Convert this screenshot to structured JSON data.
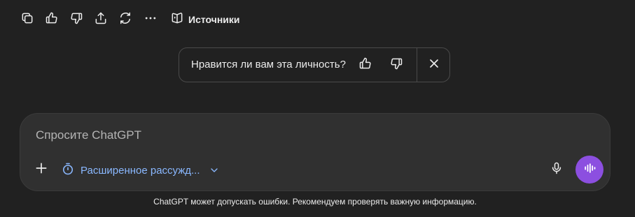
{
  "toolbar": {
    "sources_label": "Источники",
    "icons": [
      "copy-icon",
      "thumbs-up-icon",
      "thumbs-down-icon",
      "share-icon",
      "regenerate-icon",
      "more-icon",
      "book-icon"
    ]
  },
  "feedback": {
    "question": "Нравится ли вам эта личность?"
  },
  "composer": {
    "placeholder": "Спросите ChatGPT",
    "reasoning_label": "Расширенное рассужд..."
  },
  "disclaimer": "ChatGPT может допускать ошибки. Рекомендуем проверять важную информацию.",
  "colors": {
    "background": "#212121",
    "composer": "#303030",
    "accent_blue": "#8ab8ff",
    "voice_button": "#8c4fe0"
  }
}
